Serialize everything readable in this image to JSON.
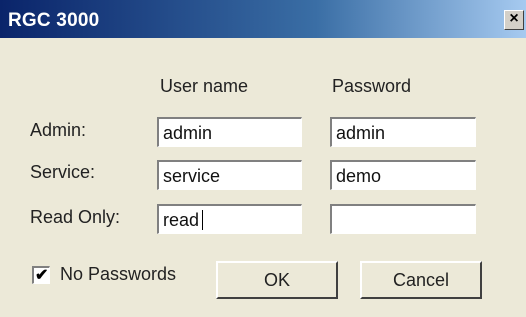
{
  "window": {
    "title": "RGC 3000",
    "close_glyph": "×"
  },
  "headers": {
    "username": "User name",
    "password": "Password"
  },
  "rows": {
    "admin": {
      "label": "Admin:",
      "username": "admin",
      "password": "admin"
    },
    "service": {
      "label": "Service:",
      "username": "service",
      "password": "demo"
    },
    "readonly": {
      "label": "Read Only:",
      "username": "read",
      "password": ""
    }
  },
  "options": {
    "no_passwords_label": "No Passwords",
    "no_passwords_checked": true,
    "check_glyph": "✔"
  },
  "buttons": {
    "ok": "OK",
    "cancel": "Cancel"
  }
}
